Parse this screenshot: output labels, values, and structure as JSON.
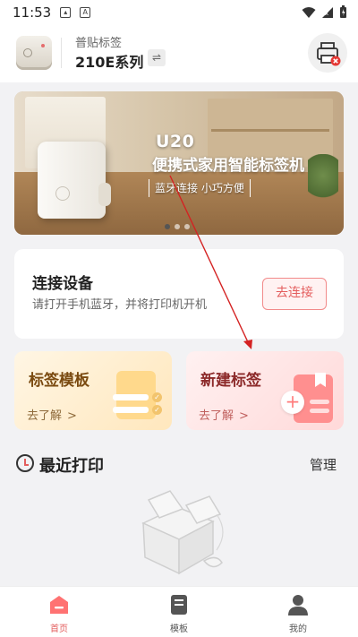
{
  "status_bar": {
    "time": "11:53"
  },
  "header": {
    "printer_subtitle": "普贴标签",
    "printer_model": "210E系列",
    "swap_icon": "swap-icon",
    "printer_status_icon": "printer-error-icon"
  },
  "banner": {
    "title_line1": "U20",
    "title_line2": "便携式家用智能标签机",
    "tagline": "蓝牙连接 小巧方便",
    "slide_count": 3,
    "active_slide": 1
  },
  "connect": {
    "title": "连接设备",
    "description": "请打开手机蓝牙，并将打印机开机",
    "button_label": "去连接"
  },
  "cards": [
    {
      "title": "标签模板",
      "link": "去了解"
    },
    {
      "title": "新建标签",
      "link": "去了解"
    }
  ],
  "recent": {
    "title": "最近打印",
    "manage_label": "管理"
  },
  "bottom_nav": [
    {
      "label": "首页",
      "icon": "home-icon",
      "active": true
    },
    {
      "label": "模板",
      "icon": "template-icon",
      "active": false
    },
    {
      "label": "我的",
      "icon": "profile-icon",
      "active": false
    }
  ],
  "colors": {
    "accent": "#e35e5e",
    "template_card": "#ffe7bd",
    "new_card": "#ffd9d9"
  }
}
